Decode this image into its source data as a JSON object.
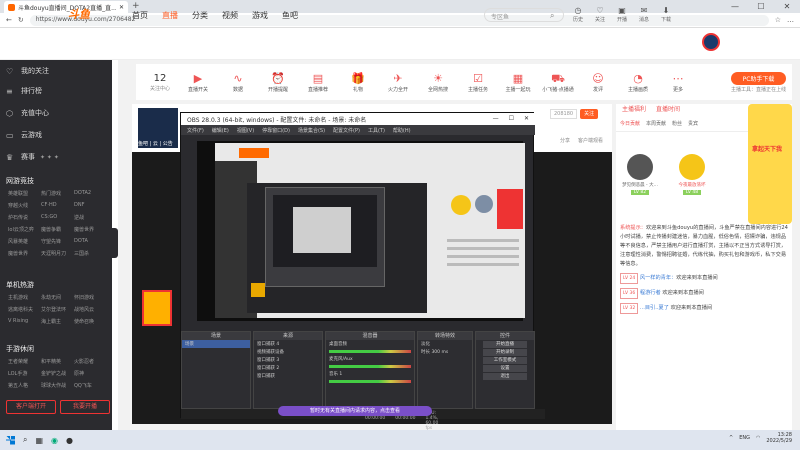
{
  "browser": {
    "tab_title": "斗鱼douyu直播间_DOTA2直播_直...",
    "url": "https://www.douyu.com/2706482",
    "win_min": "—",
    "win_max": "☐",
    "win_close": "✕",
    "new_tab": "+"
  },
  "header": {
    "logo": "斗鱼",
    "nav": [
      "首页",
      "直播",
      "分类",
      "视频",
      "游戏",
      "鱼吧"
    ],
    "active_nav": "直播",
    "search_placeholder": "专区鱼",
    "icons": [
      {
        "icon": "clock",
        "label": "历史"
      },
      {
        "icon": "bell",
        "label": "关注"
      },
      {
        "icon": "clip",
        "label": "开播"
      },
      {
        "icon": "chat",
        "label": "消息"
      },
      {
        "icon": "broadcast",
        "label": "下载"
      }
    ]
  },
  "sidebar": {
    "items": [
      {
        "icon": "heart",
        "label": "我的关注"
      },
      {
        "icon": "list",
        "label": "排行榜"
      },
      {
        "icon": "shield",
        "label": "充值中心"
      },
      {
        "icon": "gamepad",
        "label": "云游戏"
      },
      {
        "icon": "trophy",
        "label": "赛事"
      }
    ],
    "sections": [
      {
        "title": "网游竞技",
        "more": "》",
        "items": [
          "英雄联盟",
          "热门游戏",
          "DOTA2",
          "穿越火线",
          "CF·HD",
          "DNF",
          "炉石传说",
          "CS:GO",
          "逆战",
          "lol云顶之弈",
          "魔兽争霸",
          "魔兽世界",
          "风暴英雄",
          "守望先锋",
          "DOTA",
          "魔兽世界",
          "天涯明月刀",
          "三国杀"
        ]
      },
      {
        "title": "单机热游",
        "more": "》",
        "items": [
          "主机游戏",
          "永劫无间",
          "怀旧游戏",
          "逃离塔科夫",
          "艾尔登法环",
          "战地风云",
          "V Rising",
          "海上霸主",
          "使命召唤"
        ]
      },
      {
        "title": "手游休闲",
        "more": "》",
        "items": [
          "王者荣耀",
          "和平精英",
          "火影忍者",
          "LOL手游",
          "金铲铲之战",
          "原神",
          "第五人格",
          "球球大作战",
          "QQ飞车"
        ]
      }
    ],
    "btn_live": "客户端打开",
    "btn_start": "我要开播"
  },
  "catbar": {
    "follow_count": "12",
    "follow_label": "关注中心",
    "items": [
      "直播开关",
      "数据",
      "开播提醒",
      "直播推荐",
      "礼物",
      "火力全开",
      "全网热搜",
      "主播任务",
      "主播一起玩",
      "小飞猪·点播通",
      "发评",
      "主播画质",
      "更多"
    ],
    "pc_btn": "PC助手下载",
    "pc_sub": "主播工具：直播正在上线"
  },
  "room": {
    "anchor_name": "鱼吧 | 云 | 公告",
    "tags": [
      "分享",
      "录屏",
      "举报",
      "画质"
    ],
    "btn_count": "208180",
    "btn_follow": "关注",
    "share": [
      "分享",
      "客户端观看"
    ]
  },
  "obs": {
    "title": "OBS 28.0.3 (64-bit, windows) - 配置文件: 未命名 - 场景: 未命名",
    "menu": [
      "文件(F)",
      "编辑(E)",
      "视图(V)",
      "停靠窗口(D)",
      "场景集合(S)",
      "配置文件(P)",
      "工具(T)",
      "帮助(H)"
    ],
    "dock_titles": [
      "场景",
      "来源",
      "混音器",
      "转场特效",
      "控件"
    ],
    "scene": "场景",
    "sources": [
      "窗口捕获 4",
      "视频捕获设备",
      "窗口捕获 3",
      "窗口捕获 2",
      "窗口捕获"
    ],
    "mixer": [
      "桌面音频",
      "麦克风/Aux",
      "音乐 1"
    ],
    "transition": "淡化",
    "duration_label": "时长",
    "duration": "300 ms",
    "controls": [
      "开始直播",
      "开始录制",
      "工作室模式",
      "设置",
      "退出"
    ],
    "status": [
      "LIVE: 00:00:00",
      "REC: 00:00:00",
      "CPU: 1.4%, 60.00 fps"
    ]
  },
  "notice": "暂时无有关直播间内请求内容，点击查看",
  "right": {
    "top": [
      "主播福利",
      "直播时间"
    ],
    "tabs": [
      "今日贡献",
      "本周贡献",
      "粉丝",
      "贵宾"
    ],
    "ranks": [
      {
        "name": "梦见倒悲晨 - 大...",
        "level": "LV 82"
      },
      {
        "name": "今夜最放荡坏",
        "level": "LV 48"
      }
    ],
    "dice_label": "拿起天下我",
    "chat": [
      {
        "type": "sys",
        "tag": "系统提示：",
        "text": "欢迎来到斗鱼douyu的直播间，斗鱼严禁在直播间内容进行24小时试播，禁止传播封建迷信，暴力血腥，低俗色情，招嫖诈骗，违规品等不良信息，严禁主播用户进行直播打赏，主播以不正当方式诱导打赏，注意理性消费，警惕招聘征婚，代练代抽，购买礼包和游戏币，私下交易等信息。"
      },
      {
        "tag": "LV 24",
        "name": "风一样的青年：",
        "text": "欢迎来到本直播间"
      },
      {
        "tag": "LV 36",
        "name": "程游行者",
        "text": "欢迎来到本直播间"
      },
      {
        "tag": "LV 32",
        "name": "...目引..夏了",
        "text": "欢迎来到本直播间"
      }
    ]
  },
  "taskbar": {
    "apps": [
      "windows",
      "search",
      "widgets",
      "edge",
      "obs"
    ],
    "lang": "ENG",
    "time": "13:28",
    "date": "2022/5/29"
  }
}
